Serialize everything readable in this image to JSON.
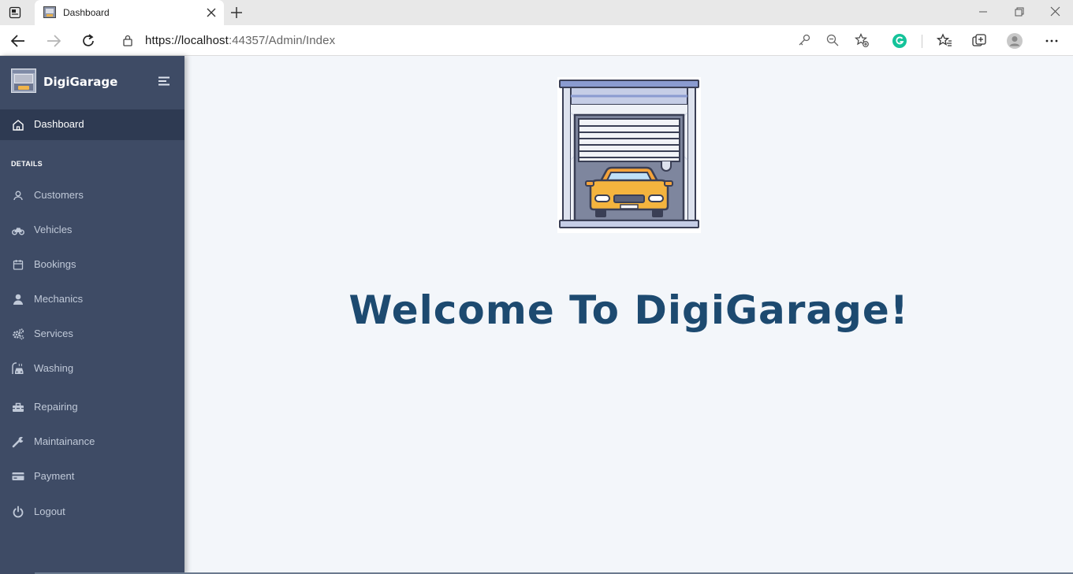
{
  "browser": {
    "tab_title": "Dashboard",
    "url_host": "https://localhost",
    "url_rest": ":44357/Admin/Index"
  },
  "sidebar": {
    "brand": "DigiGarage",
    "active_item": "Dashboard",
    "section_label": "DETAILS",
    "items": [
      {
        "label": "Customers",
        "icon": "user-icon"
      },
      {
        "label": "Vehicles",
        "icon": "motorcycle-icon"
      },
      {
        "label": "Bookings",
        "icon": "calendar-icon"
      },
      {
        "label": "Mechanics",
        "icon": "person-icon"
      },
      {
        "label": "Services",
        "icon": "gears-icon"
      },
      {
        "label": "Washing",
        "icon": "car-wash-icon"
      },
      {
        "label": "Repairing",
        "icon": "toolbox-icon"
      },
      {
        "label": "Maintainance",
        "icon": "wrench-icon"
      },
      {
        "label": "Payment",
        "icon": "credit-card-icon"
      },
      {
        "label": "Logout",
        "icon": "power-icon"
      }
    ]
  },
  "main": {
    "welcome": "Welcome To DigiGarage!"
  },
  "colors": {
    "sidebar_bg": "#3e4b65",
    "sidebar_active": "#2e3a52",
    "page_bg": "#f3f6fa",
    "heading": "#1d4a70"
  }
}
